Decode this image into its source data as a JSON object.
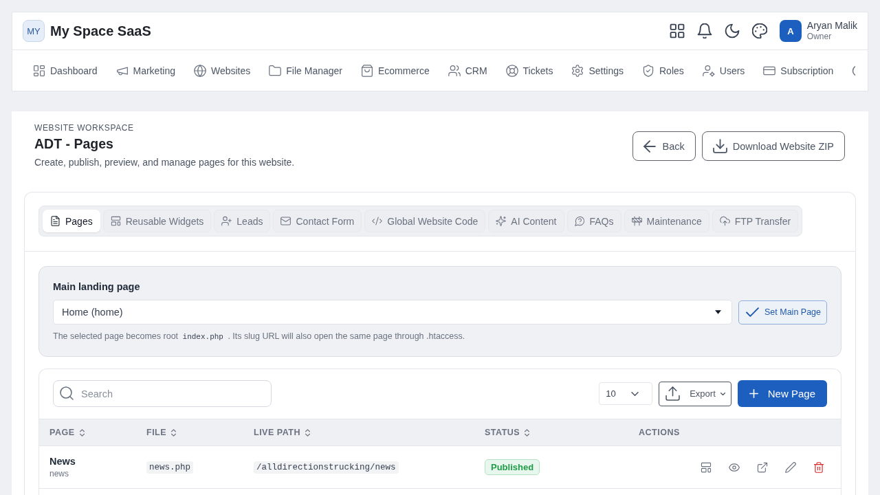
{
  "brand": {
    "logo": "MY",
    "name": "My Space SaaS"
  },
  "user": {
    "avatar": "A",
    "name": "Aryan Malik",
    "role": "Owner"
  },
  "nav": [
    "Dashboard",
    "Marketing",
    "Websites",
    "File Manager",
    "Ecommerce",
    "CRM",
    "Tickets",
    "Settings",
    "Roles",
    "Users",
    "Subscription"
  ],
  "header": {
    "eyebrow": "WEBSITE WORKSPACE",
    "title": "ADT - Pages",
    "subtitle": "Create, publish, preview, and manage pages for this website.",
    "buttons": [
      "Back",
      "Download Website ZIP"
    ]
  },
  "tabs": [
    {
      "label": "Pages",
      "selected": true
    },
    {
      "label": "Reusable Widgets",
      "selected": false
    },
    {
      "label": "Leads",
      "selected": false
    },
    {
      "label": "Contact Form",
      "selected": false
    },
    {
      "label": "Global Website Code",
      "selected": false
    },
    {
      "label": "AI Content",
      "selected": false
    },
    {
      "label": "FAQs",
      "selected": false
    },
    {
      "label": "Maintenance",
      "selected": false
    },
    {
      "label": "FTP Transfer",
      "selected": false
    }
  ],
  "main_landing": {
    "label": "Main landing page",
    "value": "Home (home)",
    "button": "Set Main Page",
    "help": {
      "before": "The selected page becomes root",
      "code": "index.php",
      "after": ". Its slug URL will also open the same page through .htaccess."
    }
  },
  "table": {
    "search": {
      "placeholder": "Search"
    },
    "page_size": "10",
    "export": "Export",
    "new_button": "New Page",
    "columns": [
      {
        "label": "PAGE",
        "sortable": true
      },
      {
        "label": "FILE",
        "sortable": true
      },
      {
        "label": "LIVE PATH",
        "sortable": true
      },
      {
        "label": "STATUS",
        "sortable": true
      },
      {
        "label": "ACTIONS",
        "sortable": false
      }
    ],
    "rows": [
      {
        "title": "News",
        "slug": "news",
        "file": "news.php",
        "live_path": "/alldirectionstrucking/news",
        "status": "Published"
      }
    ]
  }
}
